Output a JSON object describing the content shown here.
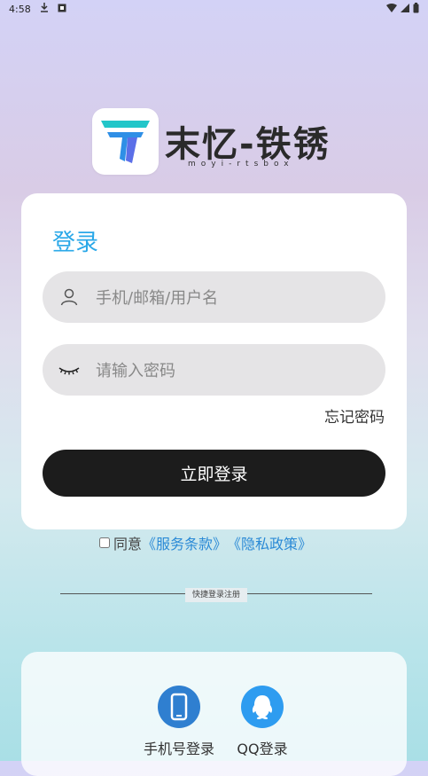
{
  "status_bar": {
    "time": "4:58"
  },
  "logo": {
    "title": "末忆-铁锈",
    "subtitle": "moyi-rtsbox"
  },
  "login": {
    "title": "登录",
    "username_placeholder": "手机/邮箱/用户名",
    "password_placeholder": "请输入密码",
    "forgot_label": "忘记密码",
    "submit_label": "立即登录"
  },
  "agreement": {
    "agree_label": "同意",
    "terms_label": "《服务条款》",
    "privacy_label": "《隐私政策》"
  },
  "quick_login": {
    "divider_label": "快捷登录注册",
    "items": [
      {
        "label": "手机号登录",
        "color": "#2f7fd0"
      },
      {
        "label": "QQ登录",
        "color": "#2e9cf0"
      }
    ]
  }
}
